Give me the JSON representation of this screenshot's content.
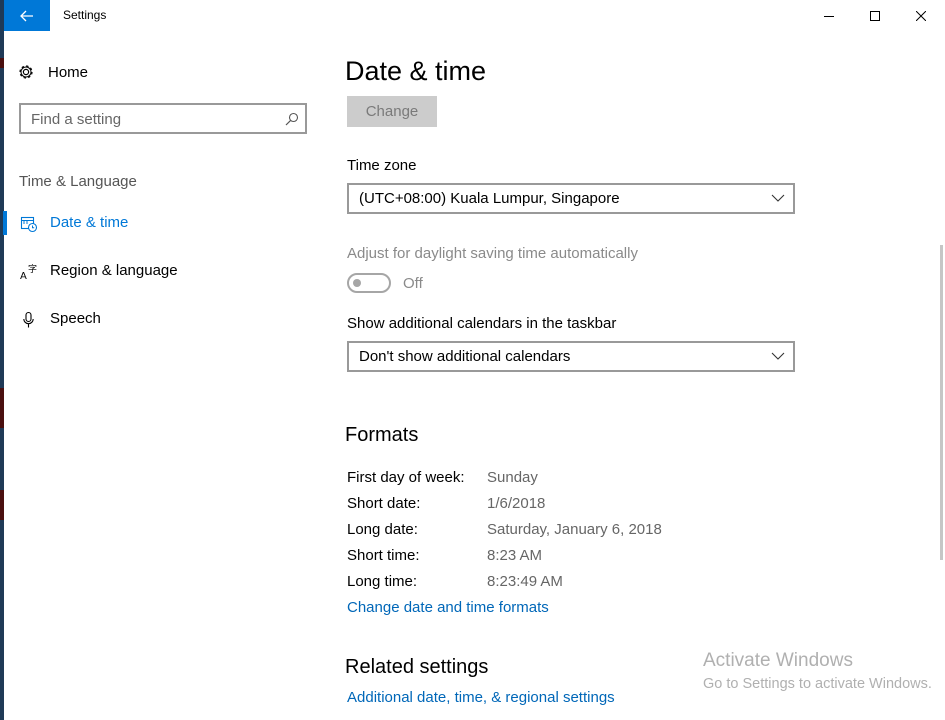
{
  "window": {
    "title": "Settings",
    "controls": [
      "minimize",
      "maximize",
      "close"
    ]
  },
  "sidebar": {
    "home_label": "Home",
    "search_placeholder": "Find a setting",
    "section_label": "Time & Language",
    "items": [
      {
        "label": "Date & time",
        "icon": "calendar-clock-icon",
        "selected": true
      },
      {
        "label": "Region & language",
        "icon": "language-icon",
        "selected": false
      },
      {
        "label": "Speech",
        "icon": "microphone-icon",
        "selected": false
      }
    ]
  },
  "main": {
    "title": "Date & time",
    "change_button": "Change",
    "timezone": {
      "label": "Time zone",
      "value": "(UTC+08:00) Kuala Lumpur, Singapore"
    },
    "daylight": {
      "label": "Adjust for daylight saving time automatically",
      "state": "Off"
    },
    "calendars": {
      "label": "Show additional calendars in the taskbar",
      "value": "Don't show additional calendars"
    },
    "formats": {
      "heading": "Formats",
      "rows": [
        {
          "key": "First day of week:",
          "value": "Sunday"
        },
        {
          "key": "Short date:",
          "value": "1/6/2018"
        },
        {
          "key": "Long date:",
          "value": "Saturday, January 6, 2018"
        },
        {
          "key": "Short time:",
          "value": "8:23 AM"
        },
        {
          "key": "Long time:",
          "value": "8:23:49 AM"
        }
      ],
      "link": "Change date and time formats"
    },
    "related": {
      "heading": "Related settings",
      "link": "Additional date, time, & regional settings"
    }
  },
  "watermark": {
    "line1": "Activate Windows",
    "line2": "Go to Settings to activate Windows."
  },
  "colors": {
    "accent": "#0078d7",
    "link": "#0067b8",
    "disabled_button": "#cccccc"
  }
}
